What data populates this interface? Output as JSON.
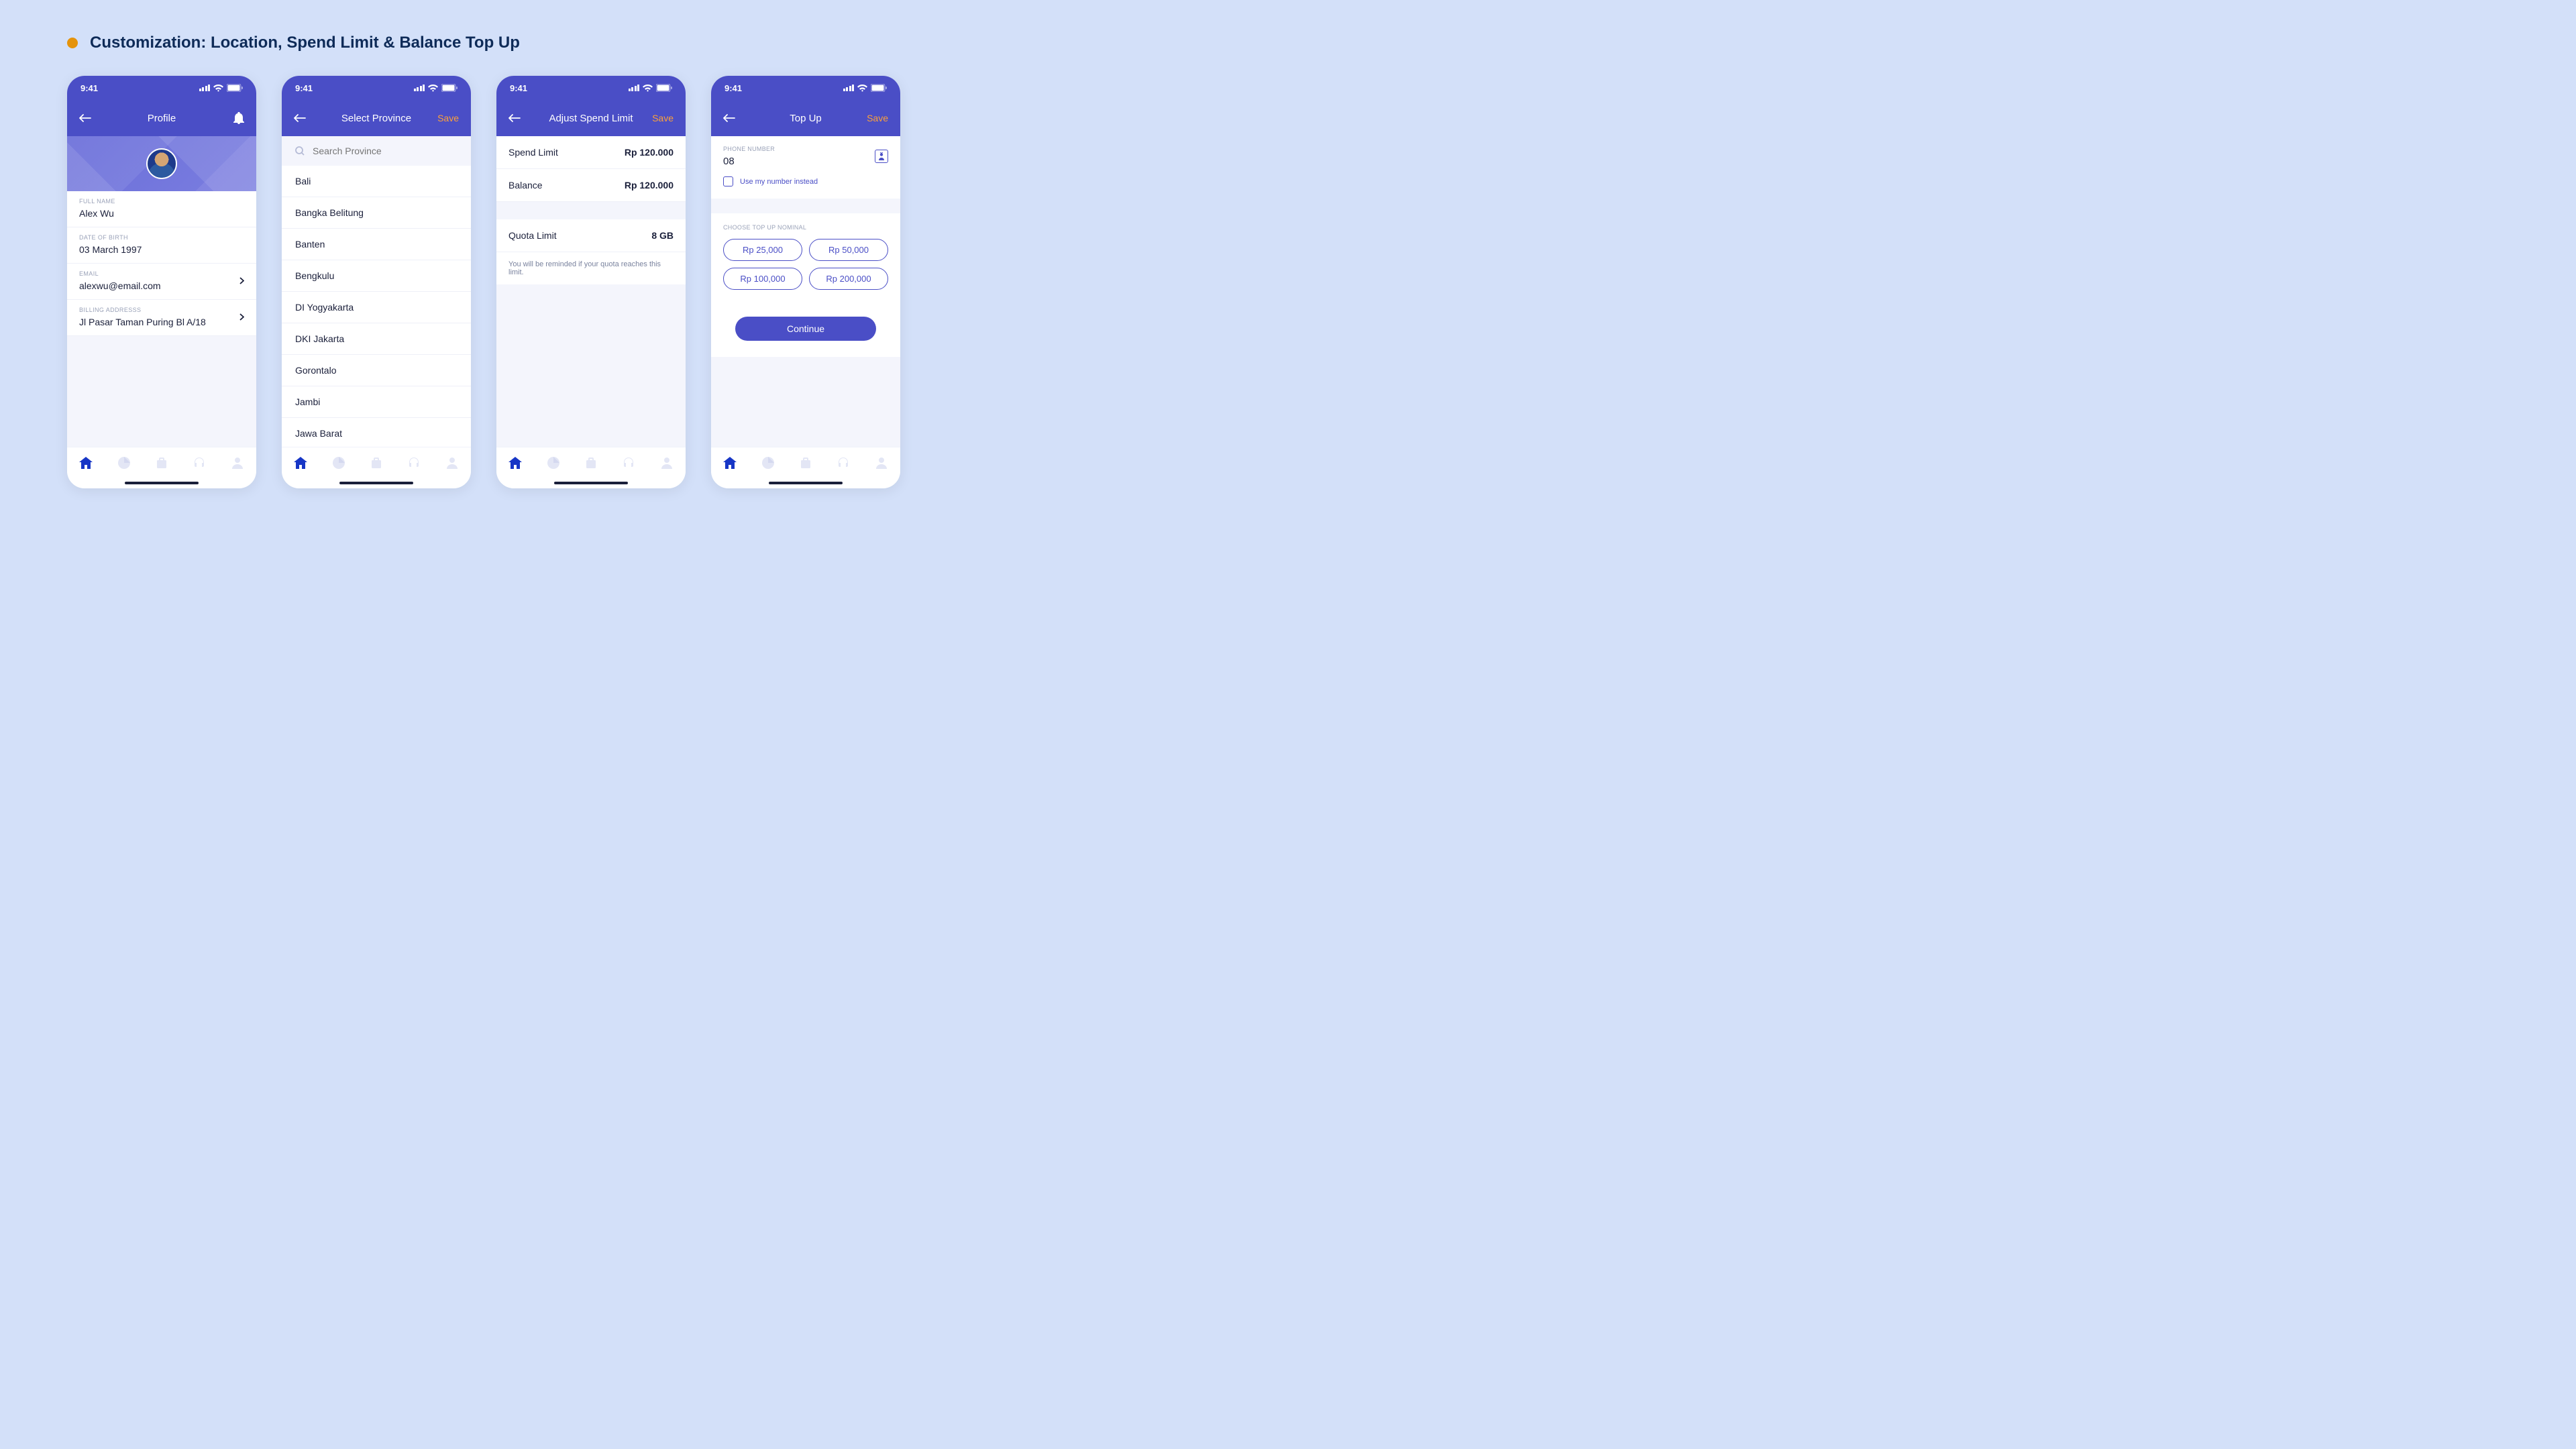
{
  "page_title": "Customization: Location, Spend Limit & Balance Top Up",
  "status_time": "9:41",
  "save_label": "Save",
  "screen1": {
    "title": "Profile",
    "full_name_label": "FULL NAME",
    "full_name_value": "Alex Wu",
    "dob_label": "DATE OF BIRTH",
    "dob_value": "03 March 1997",
    "email_label": "EMAIL",
    "email_value": "alexwu@email.com",
    "address_label": "BILLING ADDRESSS",
    "address_value": "Jl Pasar Taman Puring Bl A/18"
  },
  "screen2": {
    "title": "Select Province",
    "search_placeholder": "Search Province",
    "items": [
      "Bali",
      "Bangka Belitung",
      "Banten",
      "Bengkulu",
      "DI Yogyakarta",
      "DKI Jakarta",
      "Gorontalo",
      "Jambi",
      "Jawa Barat"
    ]
  },
  "screen3": {
    "title": "Adjust Spend Limit",
    "spend_label": "Spend Limit",
    "spend_value": "Rp 120.000",
    "balance_label": "Balance",
    "balance_value": "Rp 120.000",
    "quota_label": "Quota Limit",
    "quota_value": "8 GB",
    "hint": "You will be reminded if your quota reaches this limit."
  },
  "screen4": {
    "title": "Top Up",
    "phone_label": "PHONE NUMBER",
    "phone_value": "08",
    "use_number": "Use my number instead",
    "nominal_label": "CHOOSE TOP UP NOMINAL",
    "nominals": [
      "Rp 25,000",
      "Rp 50,000",
      "Rp 100,000",
      "Rp 200,000"
    ],
    "continue": "Continue"
  }
}
